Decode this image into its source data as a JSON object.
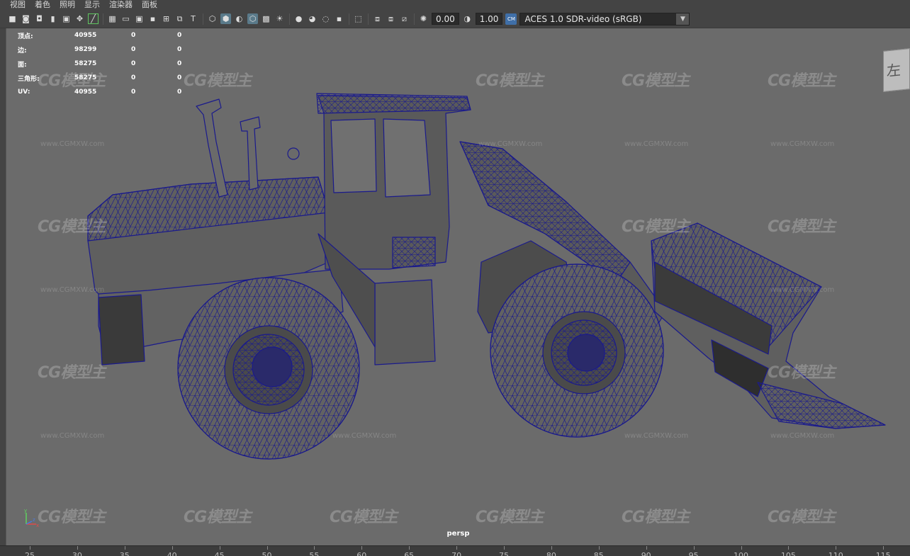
{
  "menu": [
    "视图",
    "着色",
    "照明",
    "显示",
    "渲染器",
    "面板"
  ],
  "toolbar": {
    "icons": [
      "camera-icon",
      "camera-lock-icon",
      "camera-attr-icon",
      "bookmark-icon",
      "image-plane-icon",
      "2d-pan-icon",
      "grease-pencil-icon",
      "grid-icon",
      "film-gate-icon",
      "resolution-gate-icon",
      "gate-mask-icon",
      "field-chart-icon",
      "safe-action-icon",
      "safe-title-icon",
      "wireframe-icon",
      "smooth-shade-icon",
      "default-lighting-icon",
      "wireframe-on-shaded-icon",
      "xray-icon",
      "use-lights-icon",
      "shadows-icon",
      "screen-space-ao-icon",
      "motion-blur-icon",
      "multisample-aa-icon",
      "depth-of-field-icon",
      "isolate-select-icon",
      "xray-joints-icon",
      "xray-active-icon",
      "backface-icon",
      "exposure-icon",
      "gamma-icon"
    ],
    "exposure_value": "0.00",
    "gamma_value": "1.00",
    "colorspace_badge": "CM",
    "colorspace_label": "ACES 1.0 SDR-video (sRGB)"
  },
  "hud": {
    "rows": [
      {
        "label": "顶点:",
        "v1": "40955",
        "v2": "0",
        "v3": "0"
      },
      {
        "label": "边:",
        "v1": "98299",
        "v2": "0",
        "v3": "0"
      },
      {
        "label": "面:",
        "v1": "58275",
        "v2": "0",
        "v3": "0"
      },
      {
        "label": "三角形:",
        "v1": "58275",
        "v2": "0",
        "v3": "0"
      },
      {
        "label": "UV:",
        "v1": "40955",
        "v2": "0",
        "v3": "0"
      }
    ]
  },
  "viewport": {
    "camera": "persp",
    "viewcube_label": "左",
    "watermark_logo": "CG模型主",
    "watermark_url": "www.CGMXW.com",
    "axis_labels": [
      "y",
      "x",
      "z"
    ]
  },
  "timeline": {
    "ticks": [
      25,
      30,
      35,
      40,
      45,
      50,
      55,
      60,
      65,
      70,
      75,
      80,
      85,
      90,
      95,
      100,
      105,
      110,
      115
    ]
  },
  "colors": {
    "viewport_bg": "#6b6b6b",
    "wire": "#1a1a8c",
    "mesh_fill": "#5f5f5f"
  }
}
